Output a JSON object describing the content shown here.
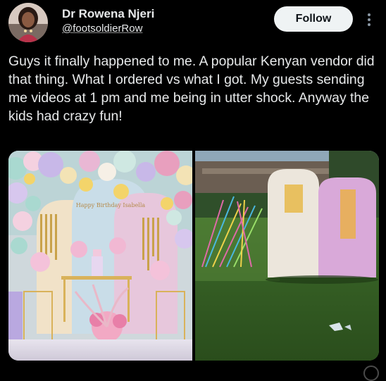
{
  "author": {
    "display_name": "Dr Rowena Njeri",
    "handle": "@footsoldierRow",
    "avatar_icon": "user-avatar"
  },
  "actions": {
    "follow_label": "Follow",
    "more_icon": "more-options-icon"
  },
  "tweet": {
    "text": "Guys it finally happened to me. A popular Kenyan vendor did that thing. What I ordered vs what I got. My guests sending me videos at 1 pm and me being in utter shock. Anyway the kids had crazy fun!"
  },
  "media": {
    "images": [
      {
        "subject": "ordered-decor",
        "backdrop_text": "Happy Birthday Isabella"
      },
      {
        "subject": "received-decor"
      }
    ]
  },
  "colors": {
    "background": "#000000",
    "text": "#e7e9ea",
    "follow_bg": "#eff3f4",
    "follow_text": "#0f1419"
  }
}
